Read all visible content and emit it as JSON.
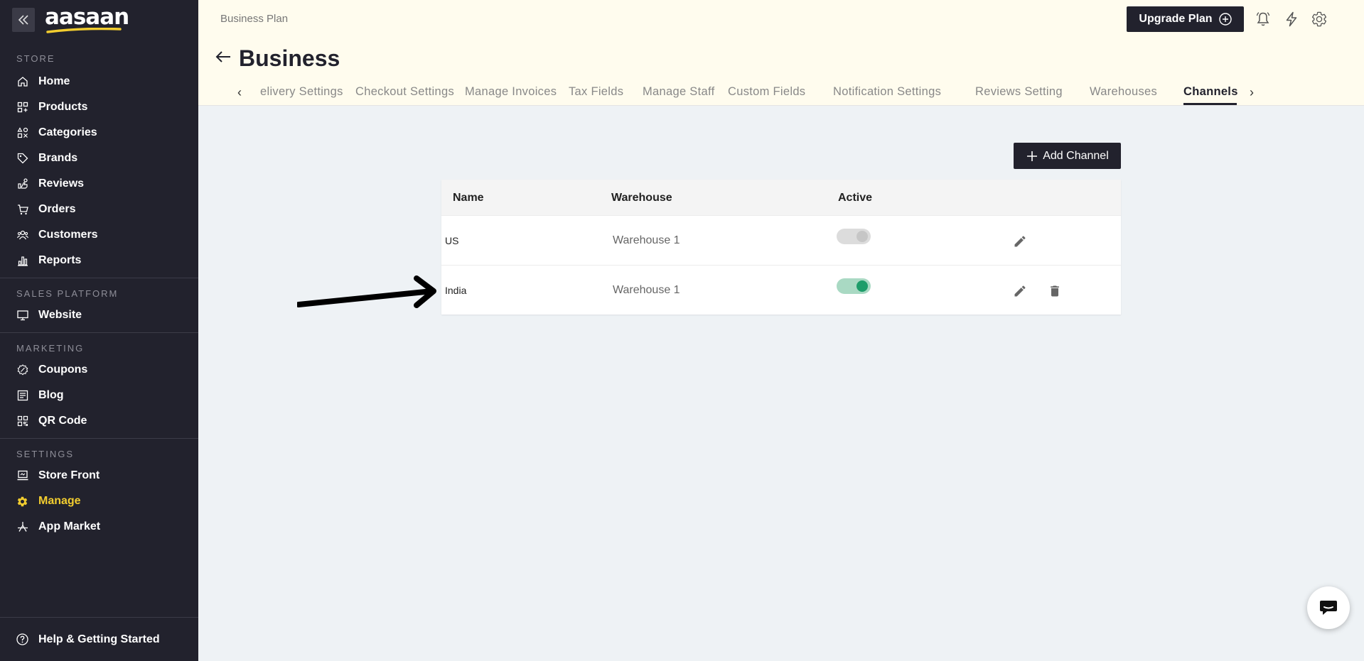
{
  "sidebar": {
    "logo": "aasaan",
    "sections": {
      "store": "STORE",
      "sales_platform": "SALES PLATFORM",
      "marketing": "MARKETING",
      "settings": "SETTINGS"
    },
    "items": {
      "home": "Home",
      "products": "Products",
      "categories": "Categories",
      "brands": "Brands",
      "reviews": "Reviews",
      "orders": "Orders",
      "customers": "Customers",
      "reports": "Reports",
      "website": "Website",
      "coupons": "Coupons",
      "blog": "Blog",
      "qr_code": "QR Code",
      "store_front": "Store Front",
      "manage": "Manage",
      "app_market": "App Market"
    },
    "active_item": "Manage",
    "help": "Help & Getting Started"
  },
  "header": {
    "plan": "Business Plan",
    "upgrade": "Upgrade Plan",
    "title": "Business",
    "tabs": [
      "elivery Settings",
      "Checkout Settings",
      "Manage Invoices",
      "Tax Fields",
      "Manage Staff",
      "Custom Fields",
      "Notification Settings",
      "Reviews Setting",
      "Warehouses",
      "Channels"
    ],
    "active_tab": "Channels"
  },
  "main": {
    "add_button": "Add Channel",
    "columns": {
      "name": "Name",
      "warehouse": "Warehouse",
      "active": "Active"
    },
    "rows": [
      {
        "name": "US",
        "warehouse": "Warehouse 1",
        "active": false
      },
      {
        "name": "India",
        "warehouse": "Warehouse 1",
        "active": true
      }
    ]
  },
  "colors": {
    "sidebar_bg": "#22222d",
    "accent_yellow": "#f2cd2f",
    "header_bg": "#fffcee",
    "toggle_on": "#1d9d6a"
  }
}
